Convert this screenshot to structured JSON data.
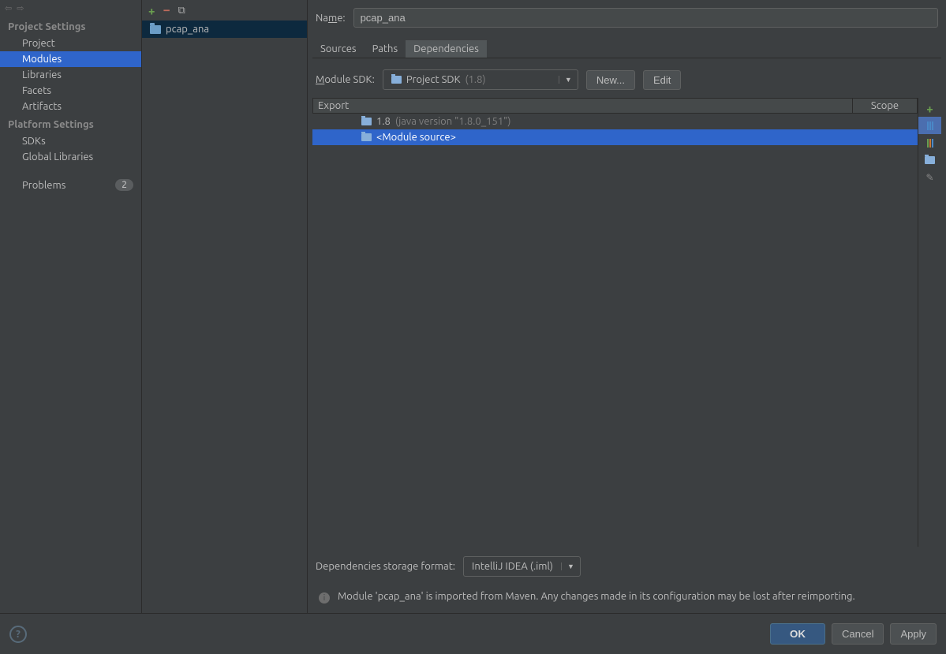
{
  "sidebar": {
    "projectSettings": {
      "header": "Project Settings",
      "items": [
        "Project",
        "Modules",
        "Libraries",
        "Facets",
        "Artifacts"
      ],
      "selectedIndex": 1
    },
    "platformSettings": {
      "header": "Platform Settings",
      "items": [
        "SDKs",
        "Global Libraries"
      ]
    },
    "problems": {
      "label": "Problems",
      "count": "2"
    }
  },
  "moduleList": {
    "items": [
      "pcap_ana"
    ]
  },
  "detail": {
    "nameLabel": "Name:",
    "nameValue": "pcap_ana",
    "tabs": [
      "Sources",
      "Paths",
      "Dependencies"
    ],
    "activeTab": 2,
    "sdk": {
      "label": "Module SDK:",
      "value": "Project SDK",
      "version": "(1.8)",
      "newBtn": "New...",
      "editBtn": "Edit"
    },
    "table": {
      "exportHeader": "Export",
      "scopeHeader": "Scope",
      "rows": [
        {
          "name": "1.8",
          "extra": "(java version \"1.8.0_151\")"
        },
        {
          "name": "<Module source>",
          "extra": ""
        }
      ],
      "selectedIndex": 1
    },
    "storage": {
      "label": "Dependencies storage format:",
      "value": "IntelliJ IDEA (.iml)"
    },
    "info": "Module 'pcap_ana' is imported from Maven. Any changes made in its configuration may be lost after reimporting."
  },
  "buttons": {
    "ok": "OK",
    "cancel": "Cancel",
    "apply": "Apply"
  }
}
